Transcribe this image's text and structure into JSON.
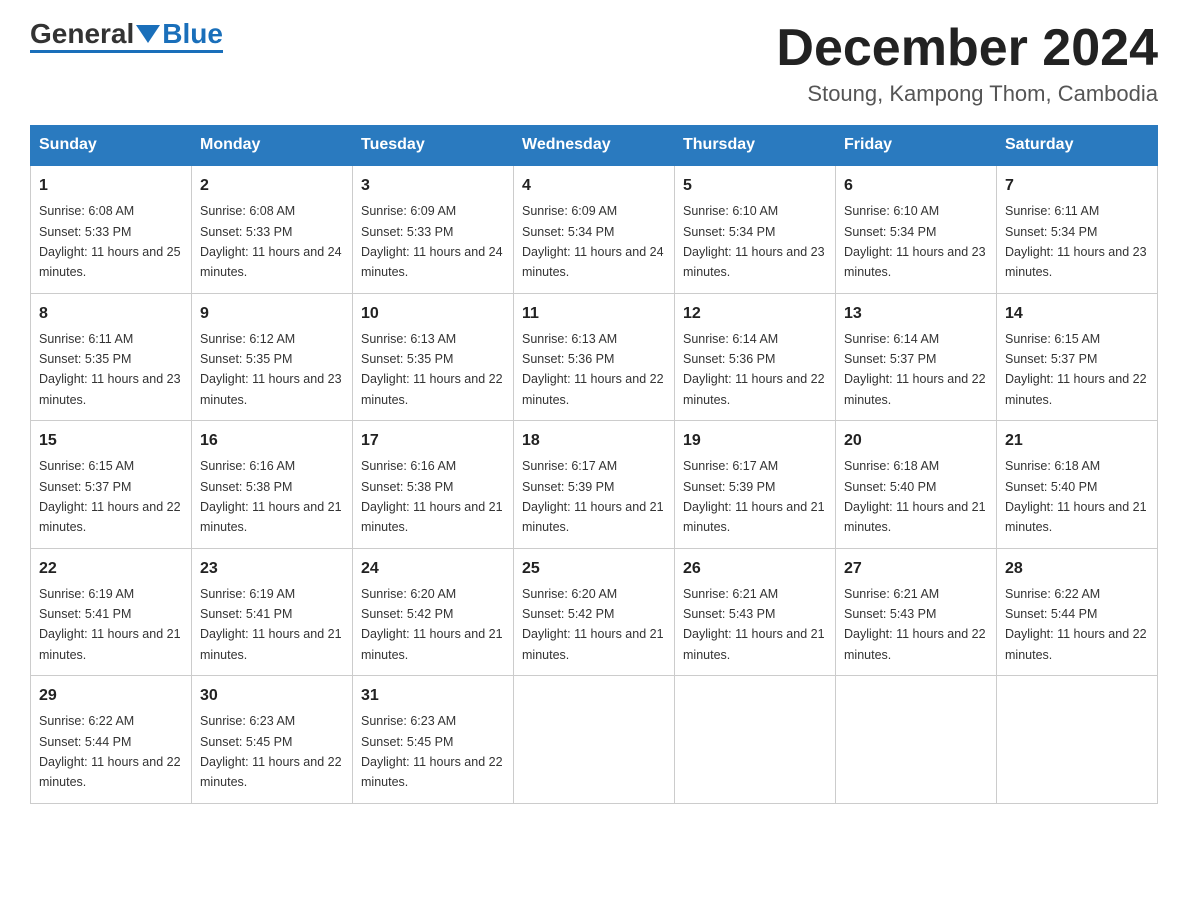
{
  "logo": {
    "text_general": "General",
    "text_blue": "Blue"
  },
  "header": {
    "month": "December 2024",
    "location": "Stoung, Kampong Thom, Cambodia"
  },
  "days_of_week": [
    "Sunday",
    "Monday",
    "Tuesday",
    "Wednesday",
    "Thursday",
    "Friday",
    "Saturday"
  ],
  "weeks": [
    [
      {
        "day": "1",
        "sunrise": "6:08 AM",
        "sunset": "5:33 PM",
        "daylight": "11 hours and 25 minutes."
      },
      {
        "day": "2",
        "sunrise": "6:08 AM",
        "sunset": "5:33 PM",
        "daylight": "11 hours and 24 minutes."
      },
      {
        "day": "3",
        "sunrise": "6:09 AM",
        "sunset": "5:33 PM",
        "daylight": "11 hours and 24 minutes."
      },
      {
        "day": "4",
        "sunrise": "6:09 AM",
        "sunset": "5:34 PM",
        "daylight": "11 hours and 24 minutes."
      },
      {
        "day": "5",
        "sunrise": "6:10 AM",
        "sunset": "5:34 PM",
        "daylight": "11 hours and 23 minutes."
      },
      {
        "day": "6",
        "sunrise": "6:10 AM",
        "sunset": "5:34 PM",
        "daylight": "11 hours and 23 minutes."
      },
      {
        "day": "7",
        "sunrise": "6:11 AM",
        "sunset": "5:34 PM",
        "daylight": "11 hours and 23 minutes."
      }
    ],
    [
      {
        "day": "8",
        "sunrise": "6:11 AM",
        "sunset": "5:35 PM",
        "daylight": "11 hours and 23 minutes."
      },
      {
        "day": "9",
        "sunrise": "6:12 AM",
        "sunset": "5:35 PM",
        "daylight": "11 hours and 23 minutes."
      },
      {
        "day": "10",
        "sunrise": "6:13 AM",
        "sunset": "5:35 PM",
        "daylight": "11 hours and 22 minutes."
      },
      {
        "day": "11",
        "sunrise": "6:13 AM",
        "sunset": "5:36 PM",
        "daylight": "11 hours and 22 minutes."
      },
      {
        "day": "12",
        "sunrise": "6:14 AM",
        "sunset": "5:36 PM",
        "daylight": "11 hours and 22 minutes."
      },
      {
        "day": "13",
        "sunrise": "6:14 AM",
        "sunset": "5:37 PM",
        "daylight": "11 hours and 22 minutes."
      },
      {
        "day": "14",
        "sunrise": "6:15 AM",
        "sunset": "5:37 PM",
        "daylight": "11 hours and 22 minutes."
      }
    ],
    [
      {
        "day": "15",
        "sunrise": "6:15 AM",
        "sunset": "5:37 PM",
        "daylight": "11 hours and 22 minutes."
      },
      {
        "day": "16",
        "sunrise": "6:16 AM",
        "sunset": "5:38 PM",
        "daylight": "11 hours and 21 minutes."
      },
      {
        "day": "17",
        "sunrise": "6:16 AM",
        "sunset": "5:38 PM",
        "daylight": "11 hours and 21 minutes."
      },
      {
        "day": "18",
        "sunrise": "6:17 AM",
        "sunset": "5:39 PM",
        "daylight": "11 hours and 21 minutes."
      },
      {
        "day": "19",
        "sunrise": "6:17 AM",
        "sunset": "5:39 PM",
        "daylight": "11 hours and 21 minutes."
      },
      {
        "day": "20",
        "sunrise": "6:18 AM",
        "sunset": "5:40 PM",
        "daylight": "11 hours and 21 minutes."
      },
      {
        "day": "21",
        "sunrise": "6:18 AM",
        "sunset": "5:40 PM",
        "daylight": "11 hours and 21 minutes."
      }
    ],
    [
      {
        "day": "22",
        "sunrise": "6:19 AM",
        "sunset": "5:41 PM",
        "daylight": "11 hours and 21 minutes."
      },
      {
        "day": "23",
        "sunrise": "6:19 AM",
        "sunset": "5:41 PM",
        "daylight": "11 hours and 21 minutes."
      },
      {
        "day": "24",
        "sunrise": "6:20 AM",
        "sunset": "5:42 PM",
        "daylight": "11 hours and 21 minutes."
      },
      {
        "day": "25",
        "sunrise": "6:20 AM",
        "sunset": "5:42 PM",
        "daylight": "11 hours and 21 minutes."
      },
      {
        "day": "26",
        "sunrise": "6:21 AM",
        "sunset": "5:43 PM",
        "daylight": "11 hours and 21 minutes."
      },
      {
        "day": "27",
        "sunrise": "6:21 AM",
        "sunset": "5:43 PM",
        "daylight": "11 hours and 22 minutes."
      },
      {
        "day": "28",
        "sunrise": "6:22 AM",
        "sunset": "5:44 PM",
        "daylight": "11 hours and 22 minutes."
      }
    ],
    [
      {
        "day": "29",
        "sunrise": "6:22 AM",
        "sunset": "5:44 PM",
        "daylight": "11 hours and 22 minutes."
      },
      {
        "day": "30",
        "sunrise": "6:23 AM",
        "sunset": "5:45 PM",
        "daylight": "11 hours and 22 minutes."
      },
      {
        "day": "31",
        "sunrise": "6:23 AM",
        "sunset": "5:45 PM",
        "daylight": "11 hours and 22 minutes."
      },
      null,
      null,
      null,
      null
    ]
  ]
}
